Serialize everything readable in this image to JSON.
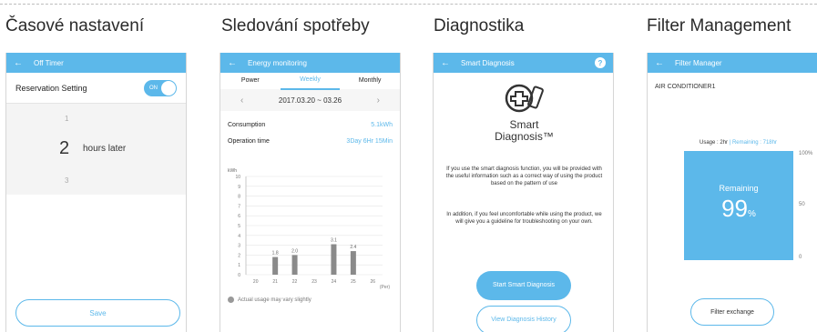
{
  "captions": [
    "Časové nastavení",
    "Sledování spotřeby",
    "Diagnostika",
    "Filter Management"
  ],
  "phone1": {
    "title": "Off Timer",
    "reservation_label": "Reservation Setting",
    "toggle_label": "ON",
    "picker_prev": "1",
    "picker_value": "2",
    "picker_unit": "hours later",
    "picker_next": "3",
    "save_label": "Save"
  },
  "phone2": {
    "title": "Energy monitoring",
    "tabs": [
      "Power",
      "Weekly",
      "Monthly"
    ],
    "active_tab": "Weekly",
    "date_range": "2017.03.20 ~ 03.26",
    "consumption_label": "Consumption",
    "consumption_value": "5.1kWh",
    "operation_label": "Operation time",
    "operation_value": "3Day 6Hr 15Min",
    "note": "Actual usage may vary slightly"
  },
  "chart_data": {
    "type": "bar",
    "categories": [
      "20",
      "21",
      "22",
      "23",
      "24",
      "25",
      "26"
    ],
    "values": [
      0,
      1.8,
      2.0,
      0,
      3.1,
      2.4,
      0
    ],
    "ylabel": "kWh",
    "xlabel": "(Per)",
    "ylim": [
      0,
      10
    ],
    "yticks": [
      0,
      1,
      2,
      3,
      4,
      5,
      6,
      7,
      8,
      9,
      10
    ],
    "bar_labels": [
      "",
      "1.8",
      "2.0",
      "",
      "3.1",
      "2.4",
      ""
    ],
    "grid": true
  },
  "phone3": {
    "title": "Smart Diagnosis",
    "brand_line1": "Smart",
    "brand_line2": "Diagnosis™",
    "para1": "If you use the smart diagnosis function, you will be provided with the useful information such as a correct way of using the product based on the pattern of use",
    "para2": "In addition, if you feel uncomfortable while using the product, we will give you a guideline for troubleshooting on your own.",
    "start_button": "Start Smart Diagnosis",
    "history_button": "View Diagnosis History"
  },
  "phone4": {
    "title": "Filter Manager",
    "device_name": "AIR CONDITIONER1",
    "usage_text": "Usage : 2hr",
    "remaining_text": "Remaining : 718hr",
    "box_label": "Remaining",
    "percent_value": "99",
    "percent_sign": "%",
    "ticks": [
      "100%",
      "50",
      "0"
    ],
    "button_label": "Filter exchange"
  },
  "colors": {
    "accent": "#5cb8ea",
    "bar": "#8a8a8a"
  }
}
